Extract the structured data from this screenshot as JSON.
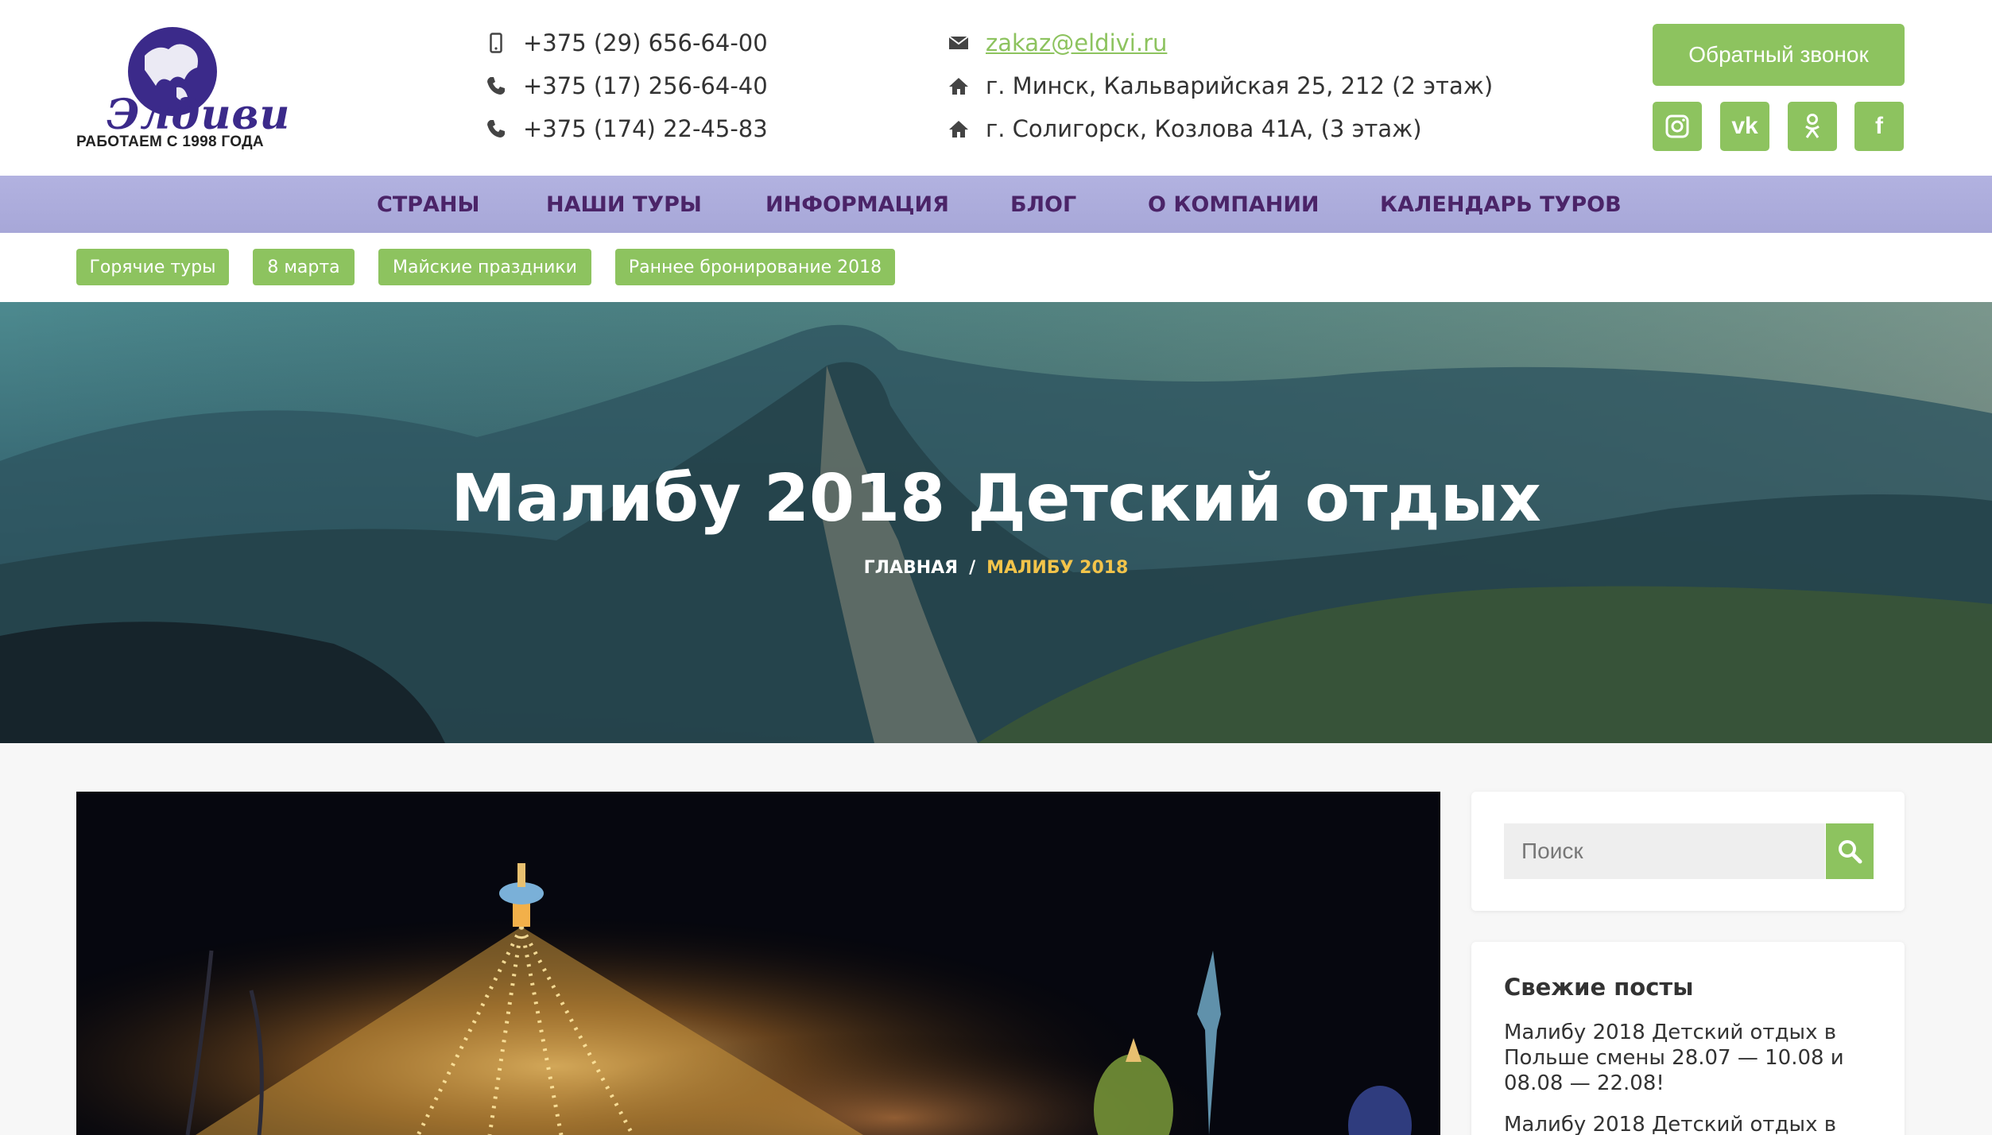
{
  "brand": {
    "logo_script": "Элдиви",
    "tagline": "РАБОТАЕМ С 1998 ГОДА"
  },
  "contacts": {
    "phones": [
      {
        "icon": "mobile-phone-icon",
        "text": "+375 (29) 656-64-00"
      },
      {
        "icon": "phone-icon",
        "text": "+375 (17) 256-64-40"
      },
      {
        "icon": "phone-icon",
        "text": "+375 (174) 22-45-83"
      }
    ],
    "email": {
      "icon": "envelope-icon",
      "text": "zakaz@eldivi.ru"
    },
    "addresses": [
      {
        "icon": "home-icon",
        "text": "г. Минск, Кальварийская 25, 212 (2 этаж)"
      },
      {
        "icon": "home-icon",
        "text": "г. Солигорск, Козлова 41А, (3 этаж)"
      }
    ]
  },
  "callback_button": "Обратный звонок",
  "social": [
    {
      "name": "instagram-icon",
      "glyph": "◘"
    },
    {
      "name": "vk-icon",
      "glyph": "vk"
    },
    {
      "name": "odnoklassniki-icon",
      "glyph": "ok"
    },
    {
      "name": "facebook-icon",
      "glyph": "f"
    }
  ],
  "nav": [
    "СТРАНЫ",
    "НАШИ ТУРЫ",
    "ИНФОРМАЦИЯ",
    "БЛОГ",
    "О КОМПАНИИ",
    "КАЛЕНДАРЬ ТУРОВ"
  ],
  "tags": [
    "Горячие туры",
    "8 марта",
    "Майские праздники",
    "Раннее бронирование 2018"
  ],
  "hero": {
    "title": "Малибу 2018 Детский отдых",
    "breadcrumb": {
      "home": "ГЛАВНАЯ",
      "separator": "/",
      "current": "МАЛИБУ 2018"
    }
  },
  "search": {
    "placeholder": "Поиск"
  },
  "recent_posts": {
    "title": "Свежие посты",
    "items": [
      "Малибу 2018 Детский отдых в Польше смены 28.07 — 10.08 и 08.08 — 22.08!",
      "Малибу 2018 Детский отдых в"
    ]
  },
  "colors": {
    "accent_green": "#8dc35f",
    "nav_bg": "#aeaedd",
    "nav_text": "#4b2468",
    "breadcrumb_current": "#f3c44a",
    "logo_purple": "#3b2a8a"
  }
}
